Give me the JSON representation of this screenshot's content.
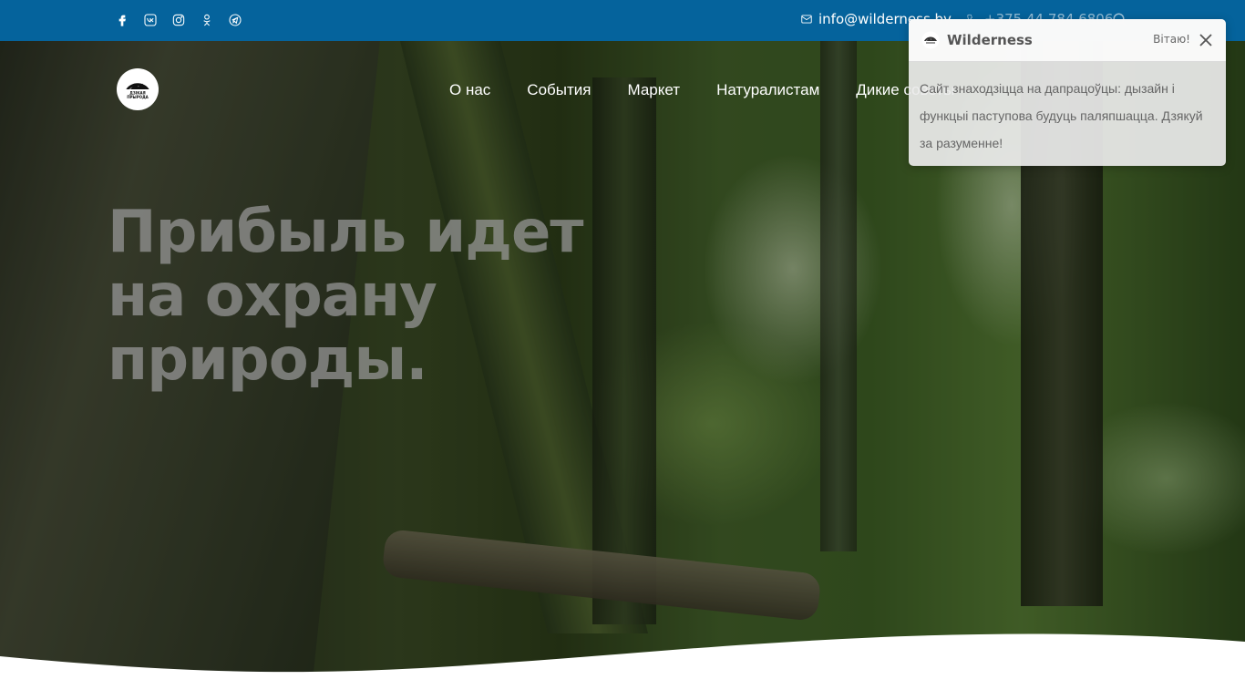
{
  "topbar": {
    "socials": [
      {
        "icon": "facebook-icon"
      },
      {
        "icon": "vk-icon"
      },
      {
        "icon": "instagram-icon"
      },
      {
        "icon": "odnoklassniki-icon"
      },
      {
        "icon": "telegram-icon"
      }
    ],
    "email": "info@wilderness.by",
    "phone": "+375 44 784 6806"
  },
  "logo": {
    "text": "ДЗІКАЯ ПРЫРОДА"
  },
  "nav": [
    "О нас",
    "События",
    "Маркет",
    "Натуралистам",
    "Дикие советы"
  ],
  "hero": {
    "headline_lines": [
      "Прибыль идет",
      "на охрану",
      "природы."
    ]
  },
  "toast": {
    "title": "Wilderness",
    "time": "Вітаю!",
    "message": "Сайт знаходзіцца на дапрацоўцы: дызайн і функцыі паступова будуць паляпшацца. Дзякуй за разуменне!"
  },
  "colors": {
    "topbar": "#05639c",
    "toast_bg": "#ebebeb"
  }
}
